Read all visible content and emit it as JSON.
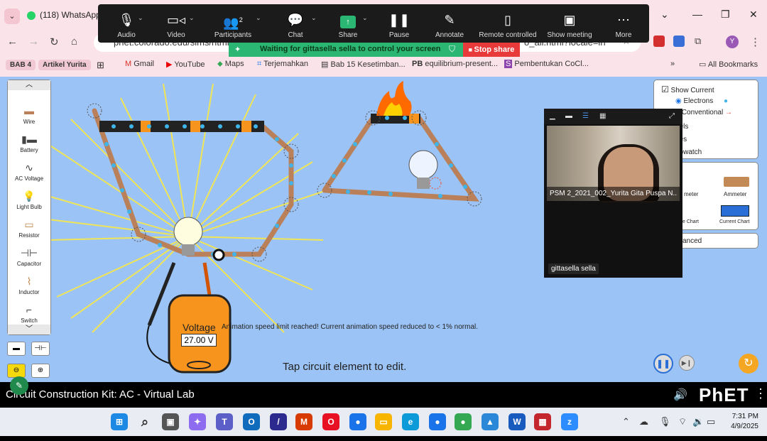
{
  "browser": {
    "tab_title": "(118) WhatsApp",
    "window_controls": [
      "⌄",
      "—",
      "❐",
      "✕"
    ],
    "address_text": "phet.colorado.edu/sims/html/",
    "address_suffix": "o_all.html?locale=in",
    "avatar_letter": "Y",
    "bookmarks": [
      {
        "label": "BAB 4",
        "chip": true
      },
      {
        "label": "Artikel Yurita",
        "chip": true
      },
      {
        "label": "Gmail"
      },
      {
        "label": "YouTube"
      },
      {
        "label": "Maps"
      },
      {
        "label": "Terjemahkan"
      },
      {
        "label": "Bab 15 Kesetimban..."
      },
      {
        "label": "equilibrium-present..."
      },
      {
        "label": "Pembentukan CoCl..."
      }
    ],
    "all_bookmarks": "All Bookmarks"
  },
  "zoom": {
    "toolbar": [
      {
        "label": "Audio",
        "icon": "mic-icon"
      },
      {
        "label": "Video",
        "icon": "camera-icon"
      },
      {
        "label": "Participants",
        "icon": "participants-icon",
        "count": "2"
      },
      {
        "label": "Chat",
        "icon": "chat-icon"
      },
      {
        "label": "Share",
        "icon": "share-icon"
      },
      {
        "label": "Pause",
        "icon": "pause-icon"
      },
      {
        "label": "Annotate",
        "icon": "pen-icon"
      },
      {
        "label": "Remote controlled",
        "icon": "mouse-icon"
      },
      {
        "label": "Show meeting",
        "icon": "meeting-icon"
      },
      {
        "label": "More",
        "icon": "more-icon"
      }
    ],
    "banner_text": "Waiting for gittasella sella to control your screen",
    "stop_share": "Stop share",
    "video_tile": {
      "participant_label": "PSM 2_2021_002_Yurita Gita Puspa N..",
      "second_participant": "gittasella sella"
    }
  },
  "sim": {
    "toolbox": [
      {
        "label": "Wire",
        "glyph": "▬"
      },
      {
        "label": "Battery",
        "glyph": "▮▬"
      },
      {
        "label": "AC Voltage",
        "glyph": "∿"
      },
      {
        "label": "Light Bulb",
        "glyph": "💡"
      },
      {
        "label": "Resistor",
        "glyph": "▭"
      },
      {
        "label": "Capacitor",
        "glyph": "⊣⊢"
      },
      {
        "label": "Inductor",
        "glyph": "⌇"
      },
      {
        "label": "Switch",
        "glyph": "⌐"
      }
    ],
    "right_panel": {
      "show_current": "Show Current",
      "electrons": "Electrons",
      "conventional": "Conventional",
      "labels_partial": "bels",
      "values_partial": "ues",
      "stopwatch_partial": "opwatch",
      "voltmeter_partial": "meter",
      "ammeter": "Ammeter",
      "voltage_chart_partial": "e Chart",
      "current_chart": "Current Chart",
      "advanced_partial": "anced"
    },
    "voltmeter": {
      "label": "Voltage",
      "value": "27.00 V"
    },
    "animation_message": "Animation speed limit reached! Current animation speed reduced to < 1% normal.",
    "tap_message": "Tap circuit element to edit.",
    "accent_orange": "#f7941d",
    "background": "#9cc3f5"
  },
  "footer": {
    "title": "Circuit Construction Kit: AC - Virtual Lab",
    "brand": "PhET"
  },
  "taskbar": {
    "time": "7:31 PM",
    "date": "4/9/2025",
    "apps": [
      {
        "name": "windows-start-icon",
        "color": "#1e88e5",
        "glyph": "⊞"
      },
      {
        "name": "search-icon",
        "color": "#e9edf3",
        "glyph": "⌕"
      },
      {
        "name": "task-view-icon",
        "color": "#555",
        "glyph": "▣"
      },
      {
        "name": "copilot-icon",
        "color": "#8e6cf0",
        "glyph": "✦"
      },
      {
        "name": "teams-icon",
        "color": "#5b5fc7",
        "glyph": "T"
      },
      {
        "name": "outlook-icon",
        "color": "#0f6cbd",
        "glyph": "O"
      },
      {
        "name": "app-icon",
        "color": "#2d2a8f",
        "glyph": "/"
      },
      {
        "name": "microsoft365-icon",
        "color": "#d83b01",
        "glyph": "M"
      },
      {
        "name": "opera-icon",
        "color": "#e81123",
        "glyph": "O"
      },
      {
        "name": "chrome-icon",
        "color": "#1a73e8",
        "glyph": "●"
      },
      {
        "name": "file-explorer-icon",
        "color": "#f7b500",
        "glyph": "▭"
      },
      {
        "name": "edge-icon",
        "color": "#0c9bd8",
        "glyph": "e"
      },
      {
        "name": "chrome-profile-icon",
        "color": "#1a73e8",
        "glyph": "●"
      },
      {
        "name": "chrome-profile2-icon",
        "color": "#34a853",
        "glyph": "●"
      },
      {
        "name": "photos-icon",
        "color": "#2b88d8",
        "glyph": "▲"
      },
      {
        "name": "word-icon",
        "color": "#185abd",
        "glyph": "W"
      },
      {
        "name": "other-app-icon",
        "color": "#c4262e",
        "glyph": "▦"
      },
      {
        "name": "zoom-icon",
        "color": "#2d8cff",
        "glyph": "z"
      }
    ]
  }
}
